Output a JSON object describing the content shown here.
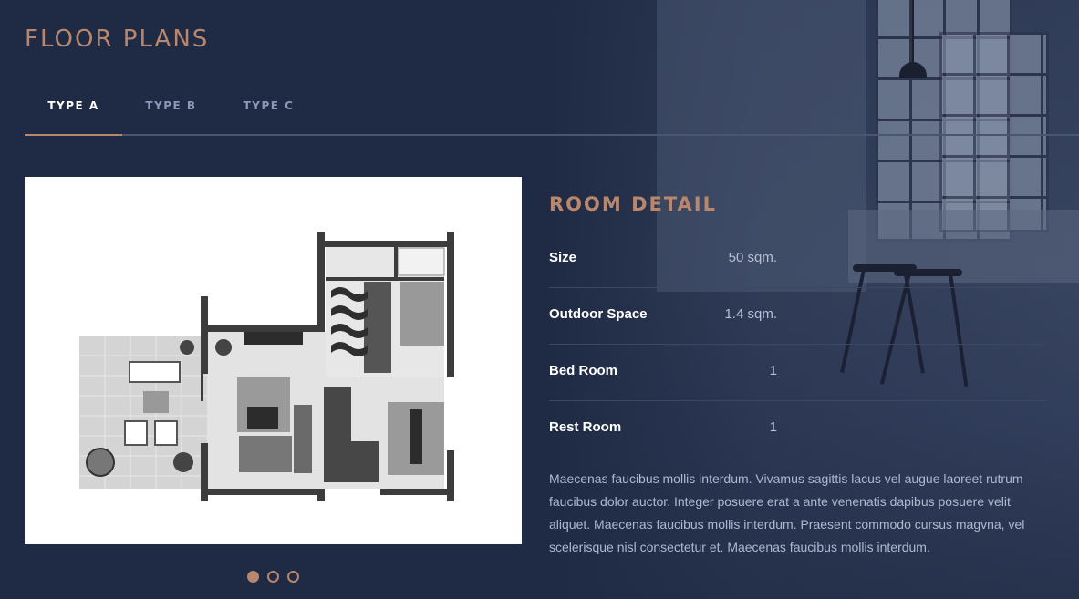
{
  "page": {
    "title": "FLOOR PLANS"
  },
  "tabs": [
    {
      "label": "TYPE A",
      "active": true
    },
    {
      "label": "TYPE B",
      "active": false
    },
    {
      "label": "TYPE C",
      "active": false
    }
  ],
  "plan": {
    "image_name": "floor-plan-type-a"
  },
  "carousel": {
    "total": 3,
    "active_index": 1
  },
  "room_detail": {
    "heading": "ROOM DETAIL",
    "rows": [
      {
        "label": "Size",
        "value": "50 sqm."
      },
      {
        "label": "Outdoor Space",
        "value": "1.4 sqm."
      },
      {
        "label": "Bed Room",
        "value": "1"
      },
      {
        "label": "Rest Room",
        "value": "1"
      }
    ],
    "description": "Maecenas faucibus mollis interdum. Vivamus sagittis lacus vel augue laoreet rutrum faucibus dolor auctor. Integer posuere erat a ante venenatis dapibus posuere velit aliquet. Maecenas faucibus mollis interdum. Praesent commodo cursus magvna, vel scelerisque nisl consectetur et. Maecenas faucibus mollis interdum."
  },
  "colors": {
    "background": "#1f2a44",
    "accent": "#b9876b",
    "muted_text": "#aeb8cf",
    "inactive_tab": "#8c98b8"
  }
}
